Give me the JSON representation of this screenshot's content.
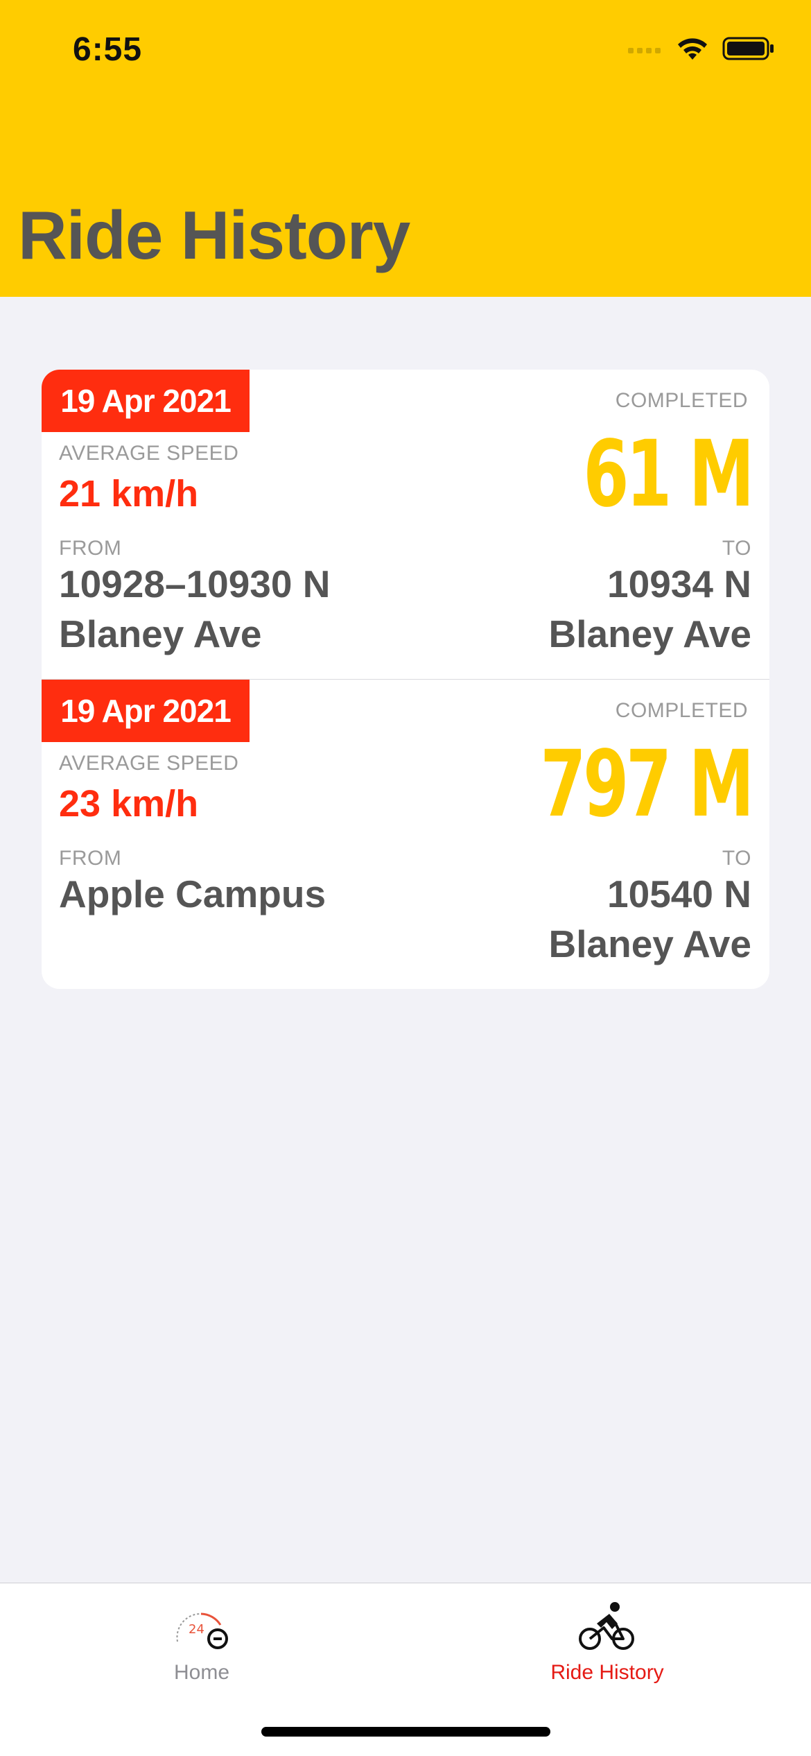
{
  "status_bar": {
    "time": "6:55"
  },
  "header": {
    "title": "Ride History"
  },
  "colors": {
    "header_bg": "#FFCC00",
    "accent_red": "#FF2D0F",
    "distance_yellow": "#FFCC00",
    "text_gray": "#555555"
  },
  "rides": [
    {
      "date": "19 Apr 2021",
      "status_label": "COMPLETED",
      "distance": "61 M",
      "speed_label": "AVERAGE SPEED",
      "speed": "21 km/h",
      "from_label": "FROM",
      "from_line1": "10928–10930 N",
      "from_line2": "Blaney Ave",
      "to_label": "TO",
      "to_line1": "10934 N",
      "to_line2": "Blaney Ave"
    },
    {
      "date": "19 Apr 2021",
      "status_label": "COMPLETED",
      "distance": "797 M",
      "speed_label": "AVERAGE SPEED",
      "speed": "23 km/h",
      "from_label": "FROM",
      "from_line1": "Apple Campus",
      "from_line2": "",
      "to_label": "TO",
      "to_line1": "10540 N",
      "to_line2": "Blaney Ave"
    }
  ],
  "tabbar": {
    "items": [
      {
        "label": "Home",
        "icon": "speedometer-bike-icon",
        "selected": false
      },
      {
        "label": "Ride History",
        "icon": "cyclist-icon",
        "selected": true
      }
    ]
  }
}
